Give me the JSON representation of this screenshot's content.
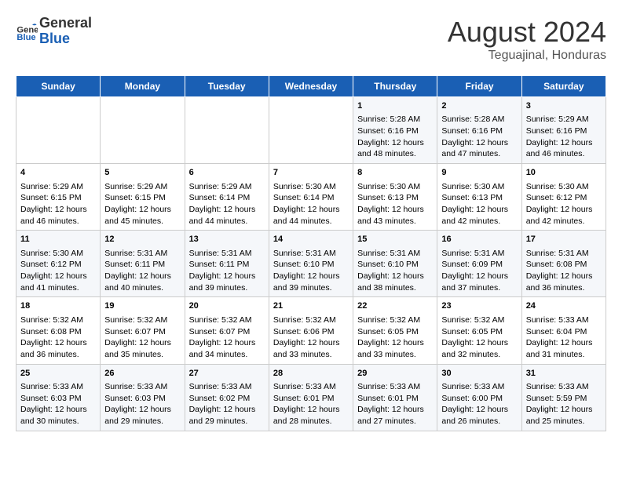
{
  "header": {
    "logo_line1": "General",
    "logo_line2": "Blue",
    "main_title": "August 2024",
    "subtitle": "Teguajinal, Honduras"
  },
  "weekdays": [
    "Sunday",
    "Monday",
    "Tuesday",
    "Wednesday",
    "Thursday",
    "Friday",
    "Saturday"
  ],
  "weeks": [
    [
      {
        "day": "",
        "text": ""
      },
      {
        "day": "",
        "text": ""
      },
      {
        "day": "",
        "text": ""
      },
      {
        "day": "",
        "text": ""
      },
      {
        "day": "1",
        "text": "Sunrise: 5:28 AM\nSunset: 6:16 PM\nDaylight: 12 hours\nand 48 minutes."
      },
      {
        "day": "2",
        "text": "Sunrise: 5:28 AM\nSunset: 6:16 PM\nDaylight: 12 hours\nand 47 minutes."
      },
      {
        "day": "3",
        "text": "Sunrise: 5:29 AM\nSunset: 6:16 PM\nDaylight: 12 hours\nand 46 minutes."
      }
    ],
    [
      {
        "day": "4",
        "text": "Sunrise: 5:29 AM\nSunset: 6:15 PM\nDaylight: 12 hours\nand 46 minutes."
      },
      {
        "day": "5",
        "text": "Sunrise: 5:29 AM\nSunset: 6:15 PM\nDaylight: 12 hours\nand 45 minutes."
      },
      {
        "day": "6",
        "text": "Sunrise: 5:29 AM\nSunset: 6:14 PM\nDaylight: 12 hours\nand 44 minutes."
      },
      {
        "day": "7",
        "text": "Sunrise: 5:30 AM\nSunset: 6:14 PM\nDaylight: 12 hours\nand 44 minutes."
      },
      {
        "day": "8",
        "text": "Sunrise: 5:30 AM\nSunset: 6:13 PM\nDaylight: 12 hours\nand 43 minutes."
      },
      {
        "day": "9",
        "text": "Sunrise: 5:30 AM\nSunset: 6:13 PM\nDaylight: 12 hours\nand 42 minutes."
      },
      {
        "day": "10",
        "text": "Sunrise: 5:30 AM\nSunset: 6:12 PM\nDaylight: 12 hours\nand 42 minutes."
      }
    ],
    [
      {
        "day": "11",
        "text": "Sunrise: 5:30 AM\nSunset: 6:12 PM\nDaylight: 12 hours\nand 41 minutes."
      },
      {
        "day": "12",
        "text": "Sunrise: 5:31 AM\nSunset: 6:11 PM\nDaylight: 12 hours\nand 40 minutes."
      },
      {
        "day": "13",
        "text": "Sunrise: 5:31 AM\nSunset: 6:11 PM\nDaylight: 12 hours\nand 39 minutes."
      },
      {
        "day": "14",
        "text": "Sunrise: 5:31 AM\nSunset: 6:10 PM\nDaylight: 12 hours\nand 39 minutes."
      },
      {
        "day": "15",
        "text": "Sunrise: 5:31 AM\nSunset: 6:10 PM\nDaylight: 12 hours\nand 38 minutes."
      },
      {
        "day": "16",
        "text": "Sunrise: 5:31 AM\nSunset: 6:09 PM\nDaylight: 12 hours\nand 37 minutes."
      },
      {
        "day": "17",
        "text": "Sunrise: 5:31 AM\nSunset: 6:08 PM\nDaylight: 12 hours\nand 36 minutes."
      }
    ],
    [
      {
        "day": "18",
        "text": "Sunrise: 5:32 AM\nSunset: 6:08 PM\nDaylight: 12 hours\nand 36 minutes."
      },
      {
        "day": "19",
        "text": "Sunrise: 5:32 AM\nSunset: 6:07 PM\nDaylight: 12 hours\nand 35 minutes."
      },
      {
        "day": "20",
        "text": "Sunrise: 5:32 AM\nSunset: 6:07 PM\nDaylight: 12 hours\nand 34 minutes."
      },
      {
        "day": "21",
        "text": "Sunrise: 5:32 AM\nSunset: 6:06 PM\nDaylight: 12 hours\nand 33 minutes."
      },
      {
        "day": "22",
        "text": "Sunrise: 5:32 AM\nSunset: 6:05 PM\nDaylight: 12 hours\nand 33 minutes."
      },
      {
        "day": "23",
        "text": "Sunrise: 5:32 AM\nSunset: 6:05 PM\nDaylight: 12 hours\nand 32 minutes."
      },
      {
        "day": "24",
        "text": "Sunrise: 5:33 AM\nSunset: 6:04 PM\nDaylight: 12 hours\nand 31 minutes."
      }
    ],
    [
      {
        "day": "25",
        "text": "Sunrise: 5:33 AM\nSunset: 6:03 PM\nDaylight: 12 hours\nand 30 minutes."
      },
      {
        "day": "26",
        "text": "Sunrise: 5:33 AM\nSunset: 6:03 PM\nDaylight: 12 hours\nand 29 minutes."
      },
      {
        "day": "27",
        "text": "Sunrise: 5:33 AM\nSunset: 6:02 PM\nDaylight: 12 hours\nand 29 minutes."
      },
      {
        "day": "28",
        "text": "Sunrise: 5:33 AM\nSunset: 6:01 PM\nDaylight: 12 hours\nand 28 minutes."
      },
      {
        "day": "29",
        "text": "Sunrise: 5:33 AM\nSunset: 6:01 PM\nDaylight: 12 hours\nand 27 minutes."
      },
      {
        "day": "30",
        "text": "Sunrise: 5:33 AM\nSunset: 6:00 PM\nDaylight: 12 hours\nand 26 minutes."
      },
      {
        "day": "31",
        "text": "Sunrise: 5:33 AM\nSunset: 5:59 PM\nDaylight: 12 hours\nand 25 minutes."
      }
    ]
  ]
}
